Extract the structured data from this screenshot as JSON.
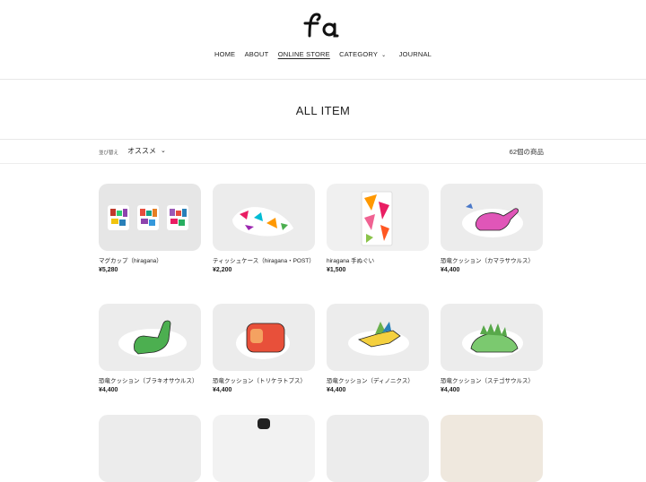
{
  "brand": {
    "logo_text": "fa"
  },
  "nav": {
    "items": [
      {
        "label": "HOME"
      },
      {
        "label": "ABOUT"
      },
      {
        "label": "ONLINE STORE"
      },
      {
        "label": "CATEGORY"
      },
      {
        "label": "JOURNAL"
      }
    ]
  },
  "page": {
    "title": "ALL ITEM"
  },
  "filter": {
    "sort_label": "並び替え",
    "sort_value": "オススメ",
    "count": "62個の商品"
  },
  "products": [
    {
      "name": "マグカップ（hiragana）",
      "price": "¥5,280"
    },
    {
      "name": "ティッシュケース（hiragana・POST）",
      "price": "¥2,200"
    },
    {
      "name": "hiragana 手ぬぐい",
      "price": "¥1,500"
    },
    {
      "name": "恐竜クッション（カマラサウルス）",
      "price": "¥4,400"
    },
    {
      "name": "恐竜クッション（ブラキオサウルス）",
      "price": "¥4,400"
    },
    {
      "name": "恐竜クッション（トリケラトプス）",
      "price": "¥4,400"
    },
    {
      "name": "恐竜クッション（ディノニクス）",
      "price": "¥4,400"
    },
    {
      "name": "恐竜クッション（ステゴサウルス）",
      "price": "¥4,400"
    }
  ]
}
